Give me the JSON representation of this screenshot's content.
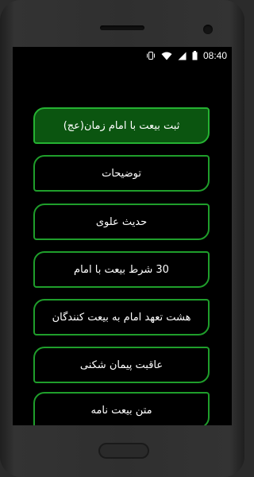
{
  "status_bar": {
    "time": "08:40",
    "icons": [
      "vibrate-icon",
      "wifi-icon",
      "signal-icon",
      "battery-icon"
    ]
  },
  "menu": {
    "items": [
      {
        "label": "ثبت بیعت با امام زمان(عج)",
        "active": true
      },
      {
        "label": "توضیحات",
        "active": false
      },
      {
        "label": "حدیث علوی",
        "active": false
      },
      {
        "label": "30 شرط بیعت با امام",
        "active": false
      },
      {
        "label": "هشت تعهد امام به بیعت کنندگان",
        "active": false
      },
      {
        "label": "عاقبت پیمان شکنی",
        "active": false
      },
      {
        "label": "متن بیعت نامه",
        "active": false
      }
    ]
  },
  "colors": {
    "button_border": "#1f9e2b",
    "active_fill": "#0b5510",
    "screen_bg": "#000000"
  }
}
